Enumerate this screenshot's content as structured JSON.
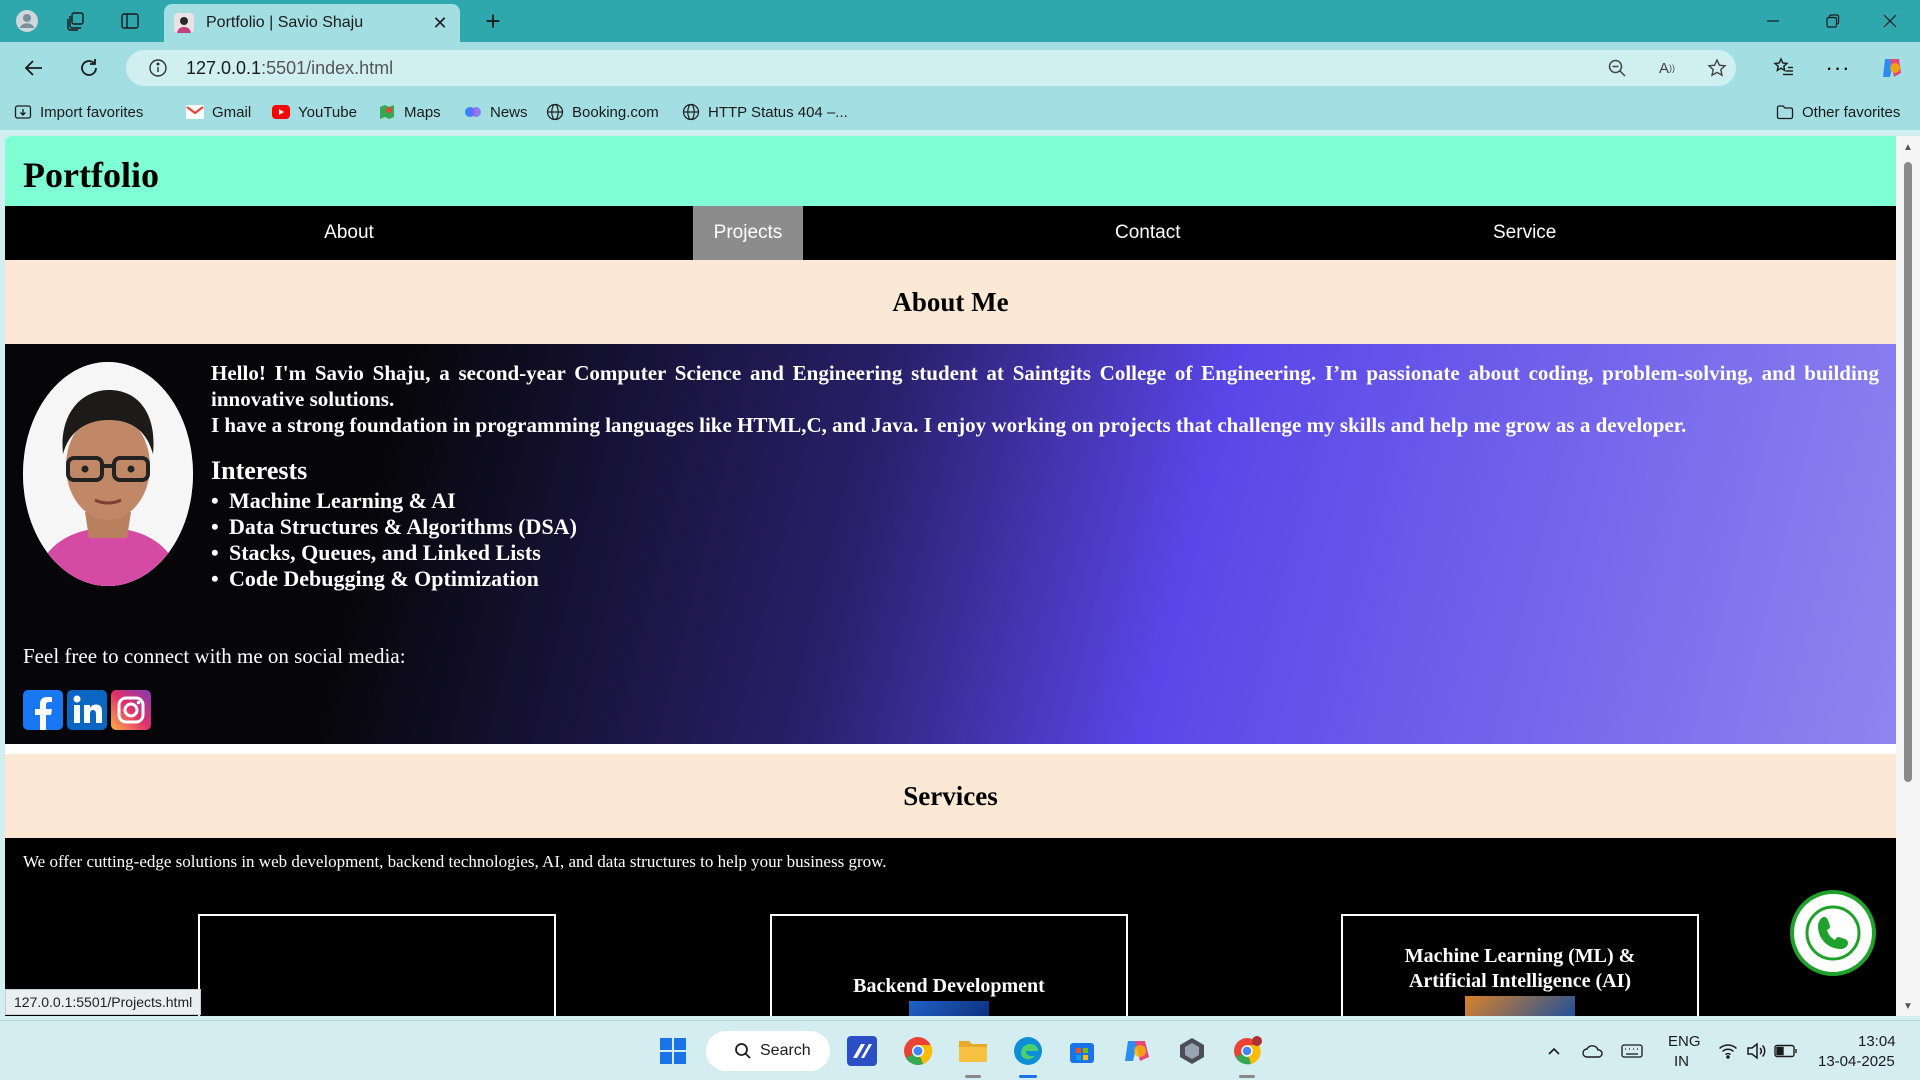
{
  "browser": {
    "tab_title": "Portfolio | Savio Shaju",
    "url_host": "127.0.0.1",
    "url_rest": ":5501/index.html",
    "bookmarks": [
      "Import favorites",
      "Gmail",
      "YouTube",
      "Maps",
      "News",
      "Booking.com",
      "HTTP Status 404 –..."
    ],
    "other_favorites": "Other favorites",
    "status_url": "127.0.0.1:5501/Projects.html"
  },
  "page": {
    "site_title": "Portfolio",
    "nav": [
      "About",
      "Projects",
      "Contact",
      "Service"
    ],
    "about_heading": "About Me",
    "intro": "Hello! I'm Savio Shaju, a second-year Computer Science and Engineering student at Saintgits College of Engineering. I’m passionate about coding, problem-solving, and building innovative solutions.",
    "intro2": "I have a strong foundation in programming languages like HTML,C, and Java. I enjoy working on projects that challenge my skills and help me grow as a developer.",
    "interests_heading": "Interests",
    "interests": [
      "Machine Learning & AI",
      "Data Structures & Algorithms (DSA)",
      "Stacks, Queues, and Linked Lists",
      "Code Debugging & Optimization"
    ],
    "connect_text": "Feel free to connect with me on social media:",
    "services_heading": "Services",
    "services_intro": "We offer cutting-edge solutions in web development, backend technologies, AI, and data structures to help your business grow.",
    "services": [
      "",
      "Backend Development",
      "Machine Learning (ML) & Artificial Intelligence (AI)"
    ]
  },
  "taskbar": {
    "search_label": "Search",
    "lang_line1": "ENG",
    "lang_line2": "IN",
    "time": "13:04",
    "date": "13-04-2025"
  },
  "colors": {
    "header_bg": "#7fffd4",
    "nav_bg": "#000000",
    "nav_hover": "#8c8c8c",
    "section_band": "#fbe9d5",
    "tab_bar": "#2ea7ad",
    "toolbar": "#a3dfe2"
  }
}
